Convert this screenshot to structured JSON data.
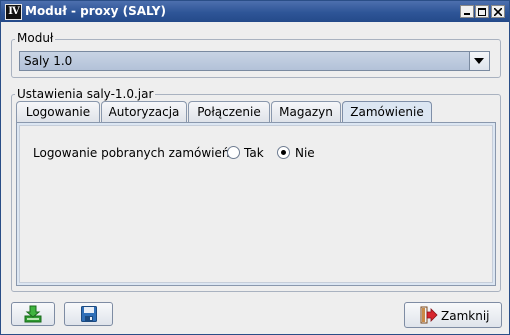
{
  "window": {
    "app_icon_text": "IV",
    "title": "Moduł - proxy (SALY)"
  },
  "modul_group": {
    "label": "Moduł",
    "selected_value": "Saly 1.0"
  },
  "settings_group": {
    "label": "Ustawienia saly-1.0.jar",
    "tabs": [
      {
        "label": "Logowanie",
        "active": false
      },
      {
        "label": "Autoryzacja",
        "active": false
      },
      {
        "label": "Połączenie",
        "active": false
      },
      {
        "label": "Magazyn",
        "active": false
      },
      {
        "label": "Zamówienie",
        "active": true
      }
    ],
    "order_logging": {
      "label": "Logowanie pobranych zamówień",
      "options": [
        {
          "label": "Tak",
          "checked": false
        },
        {
          "label": "Nie",
          "checked": true
        }
      ]
    }
  },
  "footer": {
    "import_icon": "download-icon",
    "save_icon": "floppy-disk-icon",
    "close_label": "Zamknij",
    "close_icon": "exit-door-icon"
  },
  "colors": {
    "titlebar": "#2e5597",
    "selected_tab": "#dce6f2",
    "combo": "#b3c2d8",
    "close_icon_red": "#d7262e",
    "import_icon_green": "#2e9a30",
    "save_icon_blue": "#2f6fb8"
  }
}
